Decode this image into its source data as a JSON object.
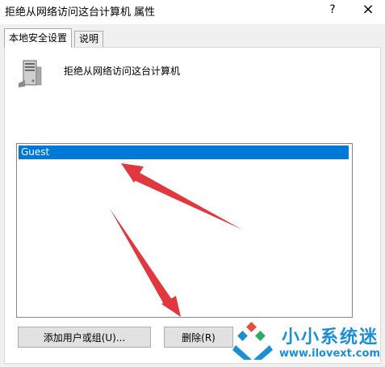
{
  "window": {
    "title": "拒绝从网络访问这台计算机 属性",
    "help_glyph": "?",
    "close_glyph": "×"
  },
  "tabs": [
    {
      "label": "本地安全设置",
      "active": true
    },
    {
      "label": "说明",
      "active": false
    }
  ],
  "policy": {
    "icon": "server-icon",
    "name": "拒绝从网络访问这台计算机"
  },
  "list": {
    "items": [
      {
        "label": "Guest",
        "selected": true
      }
    ]
  },
  "buttons": {
    "add_label": "添加用户或组(U)...",
    "remove_label": "删除(R)"
  },
  "watermark": {
    "name": "小小系统迷",
    "url": "www.ilovext.com"
  },
  "colors": {
    "selection": "#0078d7",
    "arrow": "#e0383e",
    "watermark": "#1a8fd6"
  }
}
